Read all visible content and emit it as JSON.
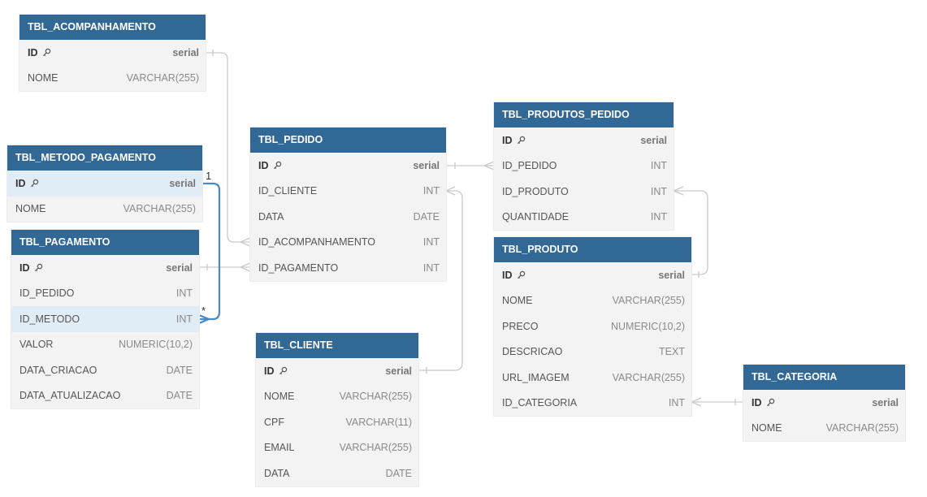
{
  "tables": [
    {
      "id": "acomp",
      "title": "TBL_ACOMPANHAMENTO",
      "fields": [
        {
          "name": "ID",
          "type": "serial",
          "pk": true
        },
        {
          "name": "NOME",
          "type": "VARCHAR(255)"
        }
      ]
    },
    {
      "id": "metodo",
      "title": "TBL_METODO_PAGAMENTO",
      "fields": [
        {
          "name": "ID",
          "type": "serial",
          "pk": true,
          "highlight": true
        },
        {
          "name": "NOME",
          "type": "VARCHAR(255)"
        }
      ]
    },
    {
      "id": "pagamento",
      "title": "TBL_PAGAMENTO",
      "fields": [
        {
          "name": "ID",
          "type": "serial",
          "pk": true
        },
        {
          "name": "ID_PEDIDO",
          "type": "INT"
        },
        {
          "name": "ID_METODO",
          "type": "INT",
          "highlight": true
        },
        {
          "name": "VALOR",
          "type": "NUMERIC(10,2)"
        },
        {
          "name": "DATA_CRIACAO",
          "type": "DATE"
        },
        {
          "name": "DATA_ATUALIZACAO",
          "type": "DATE"
        }
      ]
    },
    {
      "id": "pedido",
      "title": "TBL_PEDIDO",
      "fields": [
        {
          "name": "ID",
          "type": "serial",
          "pk": true
        },
        {
          "name": "ID_CLIENTE",
          "type": "INT"
        },
        {
          "name": "DATA",
          "type": "DATE"
        },
        {
          "name": "ID_ACOMPANHAMENTO",
          "type": "INT"
        },
        {
          "name": "ID_PAGAMENTO",
          "type": "INT"
        }
      ]
    },
    {
      "id": "cliente",
      "title": "TBL_CLIENTE",
      "fields": [
        {
          "name": "ID",
          "type": "serial",
          "pk": true
        },
        {
          "name": "NOME",
          "type": "VARCHAR(255)"
        },
        {
          "name": "CPF",
          "type": "VARCHAR(11)"
        },
        {
          "name": "EMAIL",
          "type": "VARCHAR(255)"
        },
        {
          "name": "DATA",
          "type": "DATE"
        }
      ]
    },
    {
      "id": "prodped",
      "title": "TBL_PRODUTOS_PEDIDO",
      "fields": [
        {
          "name": "ID",
          "type": "serial",
          "pk": true
        },
        {
          "name": "ID_PEDIDO",
          "type": "INT"
        },
        {
          "name": "ID_PRODUTO",
          "type": "INT"
        },
        {
          "name": "QUANTIDADE",
          "type": "INT"
        }
      ]
    },
    {
      "id": "produto",
      "title": "TBL_PRODUTO",
      "fields": [
        {
          "name": "ID",
          "type": "serial",
          "pk": true
        },
        {
          "name": "NOME",
          "type": "VARCHAR(255)"
        },
        {
          "name": "PRECO",
          "type": "NUMERIC(10,2)"
        },
        {
          "name": "DESCRICAO",
          "type": "TEXT"
        },
        {
          "name": "URL_IMAGEM",
          "type": "VARCHAR(255)"
        },
        {
          "name": "ID_CATEGORIA",
          "type": "INT"
        }
      ]
    },
    {
      "id": "categoria",
      "title": "TBL_CATEGORIA",
      "fields": [
        {
          "name": "ID",
          "type": "serial",
          "pk": true
        },
        {
          "name": "NOME",
          "type": "VARCHAR(255)"
        }
      ]
    }
  ],
  "highlighted_relation": {
    "one": "1",
    "many": "*"
  },
  "colors": {
    "header": "#316896",
    "line": "#c8c8c8",
    "highlight_line": "#4a89c4",
    "row_highlight": "#e1edf6"
  }
}
